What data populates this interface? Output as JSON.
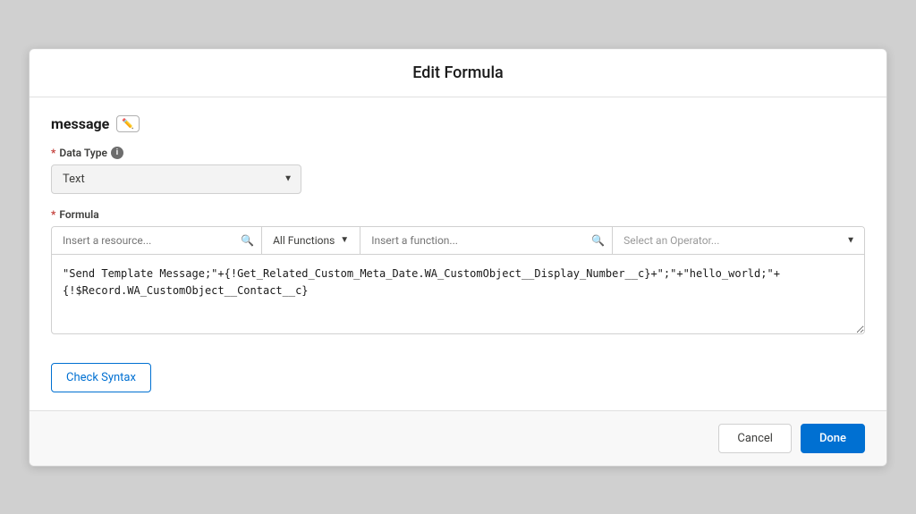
{
  "dialog": {
    "title": "Edit Formula",
    "field_name": "message",
    "data_type_label": "Data Type",
    "data_type_value": "Text",
    "formula_label": "Formula",
    "resource_placeholder": "Insert a resource...",
    "functions_dropdown_label": "All Functions",
    "function_placeholder": "Insert a function...",
    "operator_placeholder": "Select an Operator...",
    "formula_value": "\"Send Template Message;\"+{!Get_Related_Custom_Meta_Date.WA_CustomObject__Display_Number__c}+\";\"+\"hello_world;\"+\n{!$Record.WA_CustomObject__Contact__c}",
    "check_syntax_label": "Check Syntax",
    "cancel_label": "Cancel",
    "done_label": "Done"
  },
  "icons": {
    "edit": "✏",
    "info": "i",
    "search": "🔍",
    "chevron_down": "▼"
  },
  "colors": {
    "primary": "#0070d2",
    "border": "#d0d0d0",
    "required": "#c23934"
  }
}
